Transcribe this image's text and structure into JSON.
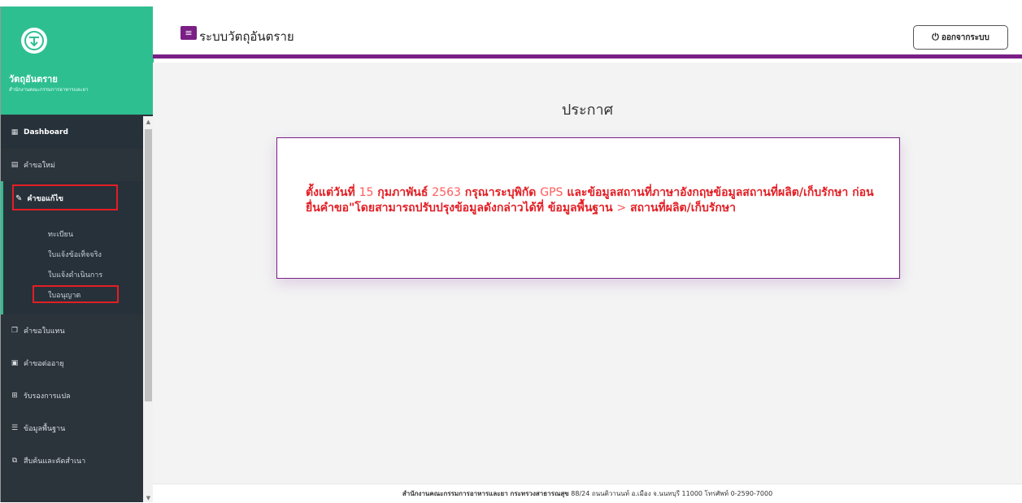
{
  "brand": {
    "title": "วัตถุอันตราย",
    "subtitle": "สำนักงานคณะกรรมการอาหารและยา"
  },
  "header": {
    "title": "ระบบวัตถุอันตราย",
    "logout_label": "ออกจากระบบ"
  },
  "sidebar": {
    "items": [
      {
        "label": "Dashboard",
        "icon": "grid-icon"
      },
      {
        "label": "คำขอใหม่",
        "icon": "document-icon"
      }
    ],
    "open_item": {
      "label": "คำขอแก้ไข",
      "icon": "edit-icon"
    },
    "sub_items": [
      {
        "label": "ทะเบียน"
      },
      {
        "label": "ใบแจ้งข้อเท็จจริง"
      },
      {
        "label": "ใบแจ้งดำเนินการ"
      },
      {
        "label": "ใบอนุญาต"
      }
    ],
    "more_items": [
      {
        "label": "คำขอใบแทน",
        "icon": "copy-icon"
      },
      {
        "label": "คำขอต่ออายุ",
        "icon": "renew-icon"
      },
      {
        "label": "รับรองการแปล",
        "icon": "translate-icon"
      },
      {
        "label": "ข้อมูลพื้นฐาน",
        "icon": "list-icon"
      },
      {
        "label": "สืบค้นและคัดสำเนา",
        "icon": "search-copy-icon"
      }
    ]
  },
  "main": {
    "page_title": "ประกาศ",
    "notice": {
      "part1": "ตั้งแต่วันที่ ",
      "num1": "15",
      "part2": " กุมภาพันธ์ ",
      "num2": "2563",
      "part3": " กรุณาระบุพิกัด ",
      "gps": "GPS",
      "part4": " และข้อมูลสถานที่ภาษาอังกฤษข้อมูลสถานที่ผลิต/เก็บรักษา ก่อนยื่นคำขอ\"โดยสามารถปรับปรุงข้อมูลดังกล่าวได้ที่ ข้อมูลพื้นฐาน ",
      "arrow": ">",
      "part5": " สถานที่ผลิต/เก็บรักษา"
    }
  },
  "footer": {
    "org": "สำนักงานคณะกรรมการอาหารและยา กระทรวงสาธารณสุข",
    "address": " 88/24 ถนนติวานนท์ อ.เมือง จ.นนทบุรี 11000 โทรศัพท์ 0-2590-7000"
  },
  "colors": {
    "accent": "#7a1f86",
    "brand": "#2ebf91",
    "sidebar": "#2b333b",
    "notice_text": "#e31e24"
  }
}
